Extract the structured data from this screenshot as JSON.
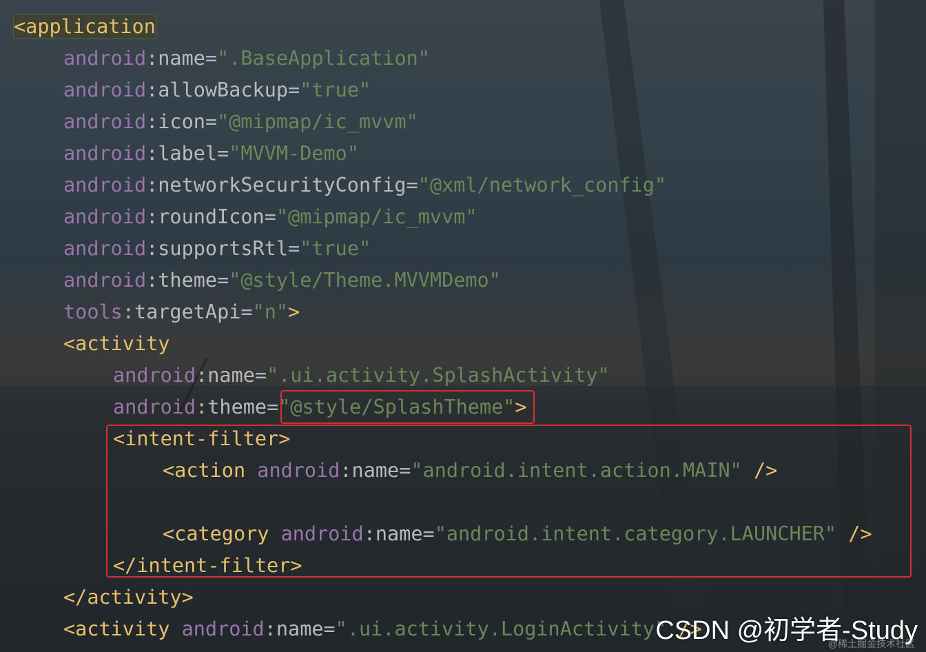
{
  "code": {
    "application_tag": "<application",
    "attrs": [
      {
        "ns": "android",
        "name": ":name",
        "value": "\".BaseApplication\""
      },
      {
        "ns": "android",
        "name": ":allowBackup",
        "value": "\"true\""
      },
      {
        "ns": "android",
        "name": ":icon",
        "value": "\"@mipmap/ic_mvvm\""
      },
      {
        "ns": "android",
        "name": ":label",
        "value": "\"MVVM-Demo\""
      },
      {
        "ns": "android",
        "name": ":networkSecurityConfig",
        "value": "\"@xml/network_config\""
      },
      {
        "ns": "android",
        "name": ":roundIcon",
        "value": "\"@mipmap/ic_mvvm\""
      },
      {
        "ns": "android",
        "name": ":supportsRtl",
        "value": "\"true\""
      },
      {
        "ns": "android",
        "name": ":theme",
        "value": "\"@style/Theme.MVVMDemo\""
      },
      {
        "ns": "tools",
        "name": ":targetApi",
        "value": "\"n\"",
        "close": ">"
      }
    ],
    "activity_open": "<activity",
    "activity_attrs": [
      {
        "ns": "android",
        "name": ":name",
        "value": "\".ui.activity.SplashActivity\""
      },
      {
        "ns": "android",
        "name": ":theme",
        "value": "\"@style/SplashTheme\"",
        "close": ">"
      }
    ],
    "intent_filter_open": "<intent-filter>",
    "action_tag": "<action",
    "action_ns": "android",
    "action_attr": ":name",
    "action_value": "\"android.intent.action.MAIN\"",
    "category_tag": "<category",
    "category_ns": "android",
    "category_attr": ":name",
    "category_value": "\"android.intent.category.LAUNCHER\"",
    "self_close": " />",
    "intent_filter_close": "</intent-filter>",
    "activity_close": "</activity>",
    "activity2_open": "<activity",
    "activity2_ns": "android",
    "activity2_attr": ":name",
    "activity2_value": "\".ui.activity.LoginActivity\"",
    "activity2_tail": " />",
    "equals": "="
  },
  "watermark": "CSDN @初学者-Study",
  "watermark_small": "@稀土掘金技术社区",
  "colors": {
    "tag": "#e8bf6a",
    "namespace": "#9876aa",
    "attribute": "#bababa",
    "string": "#6a8759",
    "highlight_box": "#d43030"
  }
}
